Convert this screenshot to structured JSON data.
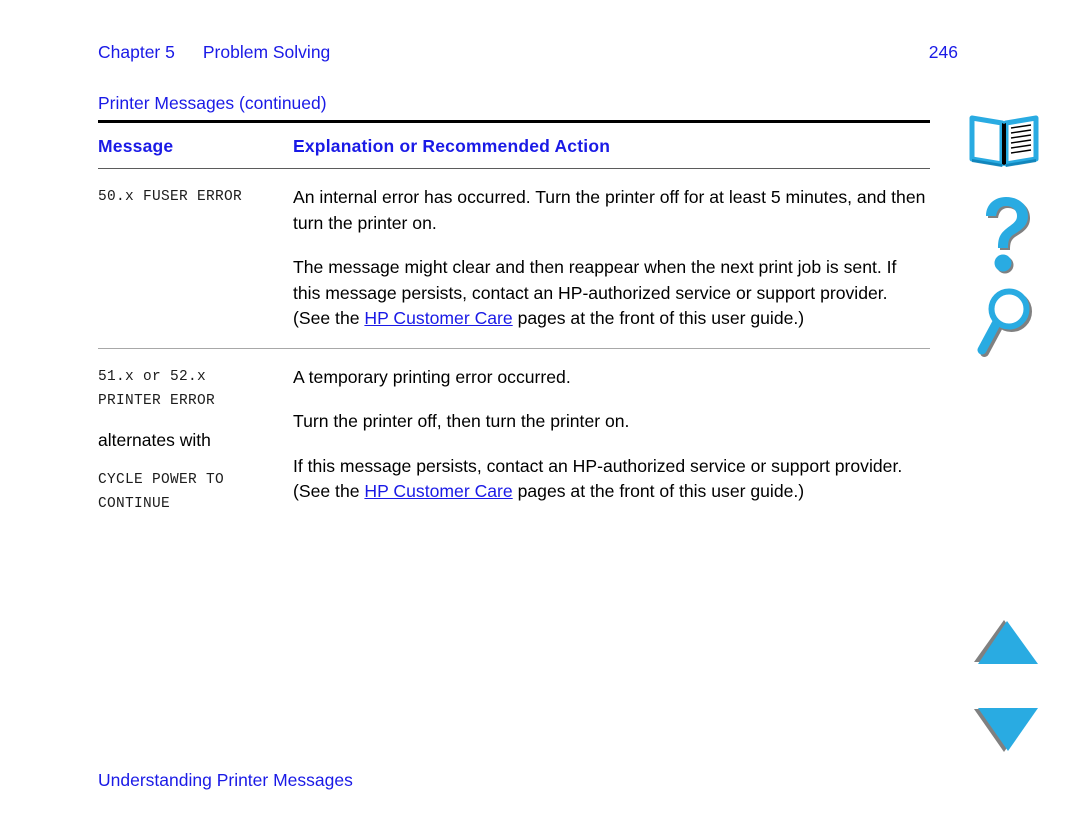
{
  "colors": {
    "link_blue": "#1a1ae6",
    "heading_blue": "#1a1ae6",
    "icon_cyan": "#29ABE2",
    "icon_shadow": "#808080",
    "rule_dark": "#000000",
    "rule_mid": "#5b5b5b",
    "rule_light": "#a8a8a8"
  },
  "running_header": {
    "chapter": "Chapter 5",
    "title": "Problem Solving",
    "page_number": "246"
  },
  "table_caption": "Printer Messages (continued)",
  "table": {
    "headers": {
      "message": "Message",
      "explanation": "Explanation or Recommended Action"
    },
    "rows": [
      {
        "message_lines": [
          "50.x FUSER ERROR"
        ],
        "alternates_label": null,
        "alternate_lines": [],
        "paragraphs": [
          {
            "segments": [
              {
                "type": "text",
                "text": "An internal error has occurred. Turn the printer off for at least 5 minutes, and then turn the printer on."
              }
            ]
          },
          {
            "segments": [
              {
                "type": "text",
                "text": "The message might clear and then reappear when the next print job is sent. If this message persists, contact an HP-authorized service or support provider. (See the "
              },
              {
                "type": "link",
                "text": "HP Customer Care"
              },
              {
                "type": "text",
                "text": " pages at the front of this user guide.)"
              }
            ]
          }
        ]
      },
      {
        "message_lines": [
          "51.x or 52.x",
          "PRINTER ERROR"
        ],
        "alternates_label": "alternates with",
        "alternate_lines": [
          "CYCLE POWER TO",
          "CONTINUE"
        ],
        "paragraphs": [
          {
            "segments": [
              {
                "type": "text",
                "text": "A temporary printing error occurred."
              }
            ]
          },
          {
            "segments": [
              {
                "type": "text",
                "text": "Turn the printer off, then turn the printer on."
              }
            ]
          },
          {
            "segments": [
              {
                "type": "text",
                "text": "If this message persists, contact an HP-authorized service or support provider. (See the "
              },
              {
                "type": "link",
                "text": "HP Customer Care"
              },
              {
                "type": "text",
                "text": " pages at the front of this user guide.)"
              }
            ]
          }
        ]
      }
    ]
  },
  "footer": "Understanding Printer Messages",
  "sidebar": {
    "icons": [
      {
        "name": "book-icon",
        "label": "Contents"
      },
      {
        "name": "question-mark-icon",
        "label": "Help"
      },
      {
        "name": "magnifier-icon",
        "label": "Find"
      },
      {
        "name": "triangle-up-icon",
        "label": "Previous page"
      },
      {
        "name": "triangle-down-icon",
        "label": "Next page"
      }
    ]
  }
}
